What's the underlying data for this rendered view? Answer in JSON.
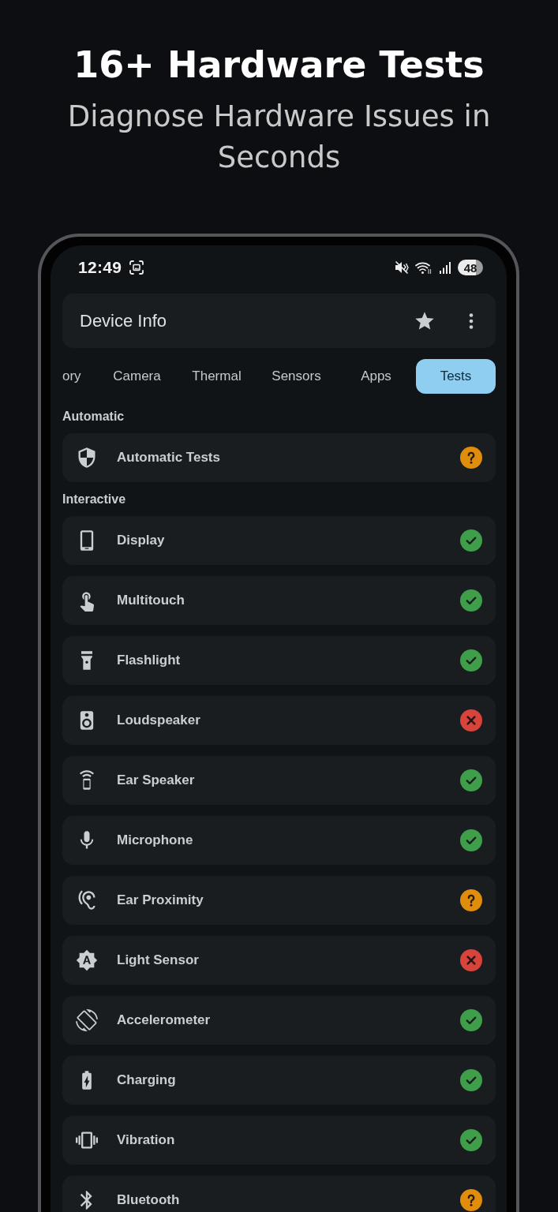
{
  "promo": {
    "headline": "16+ Hardware Tests",
    "subheadline": "Diagnose Hardware Issues in Seconds"
  },
  "status_bar": {
    "time": "12:49",
    "battery": "48"
  },
  "app_bar": {
    "title": "Device Info"
  },
  "tabs": [
    {
      "label": "ory",
      "selected": false
    },
    {
      "label": "Camera",
      "selected": false
    },
    {
      "label": "Thermal",
      "selected": false
    },
    {
      "label": "Sensors",
      "selected": false
    },
    {
      "label": "Apps",
      "selected": false
    },
    {
      "label": "Tests",
      "selected": true
    }
  ],
  "sections": [
    {
      "title": "Automatic",
      "items": [
        {
          "kind": "automatic",
          "label": "Automatic Tests",
          "passed": false,
          "failed": false
        }
      ]
    },
    {
      "title": "Interactive",
      "items": [
        {
          "kind": "display",
          "label": "Display",
          "passed": true,
          "failed": false
        },
        {
          "kind": "multitouch",
          "label": "Multitouch",
          "passed": true,
          "failed": false
        },
        {
          "kind": "flashlight",
          "label": "Flashlight",
          "passed": true,
          "failed": false
        },
        {
          "kind": "loudspeaker",
          "label": "Loudspeaker",
          "passed": false,
          "failed": true
        },
        {
          "kind": "earspeaker",
          "label": "Ear Speaker",
          "passed": true,
          "failed": false
        },
        {
          "kind": "microphone",
          "label": "Microphone",
          "passed": true,
          "failed": false
        },
        {
          "kind": "proximity",
          "label": "Ear Proximity",
          "passed": false,
          "failed": false
        },
        {
          "kind": "light",
          "label": "Light Sensor",
          "passed": false,
          "failed": true
        },
        {
          "kind": "accelerometer",
          "label": "Accelerometer",
          "passed": true,
          "failed": false
        },
        {
          "kind": "charging",
          "label": "Charging",
          "passed": true,
          "failed": false
        },
        {
          "kind": "vibration",
          "label": "Vibration",
          "passed": true,
          "failed": false
        },
        {
          "kind": "bluetooth",
          "label": "Bluetooth",
          "passed": false,
          "failed": false
        }
      ]
    }
  ]
}
